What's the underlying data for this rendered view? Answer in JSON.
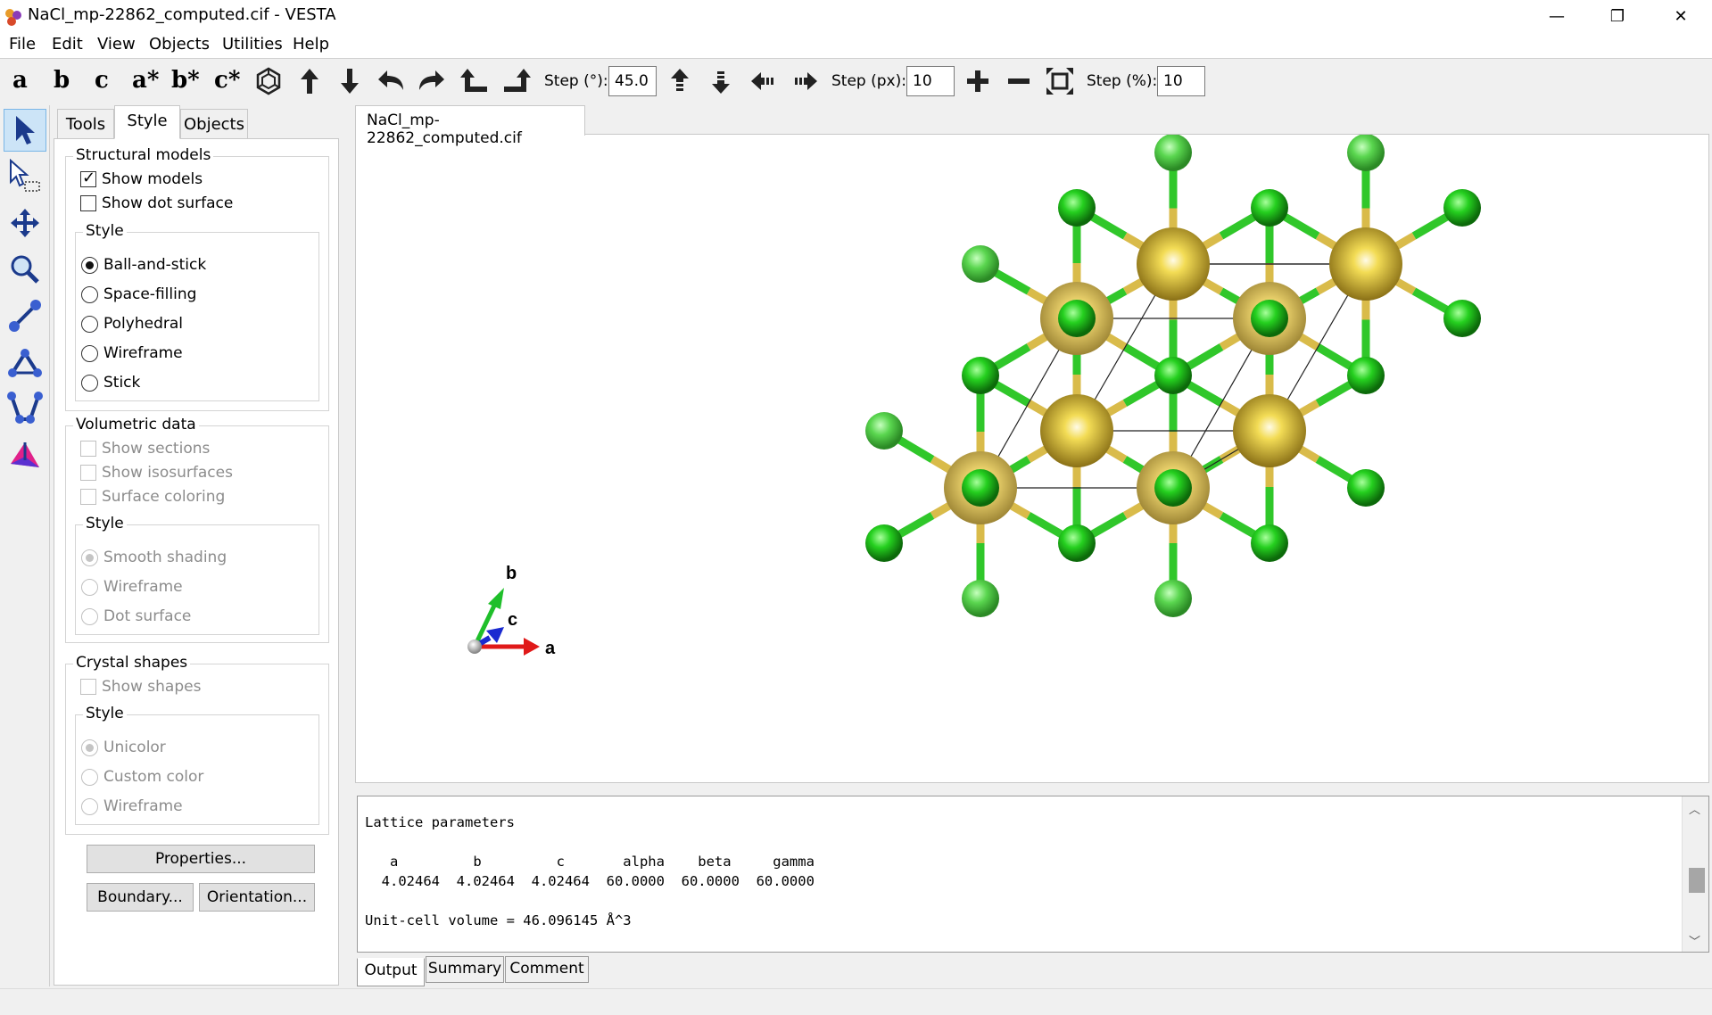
{
  "window": {
    "title": "NaCl_mp-22862_computed.cif - VESTA",
    "minimize_glyph": "—",
    "restore_glyph": "❐",
    "close_glyph": "✕"
  },
  "menu": [
    "File",
    "Edit",
    "View",
    "Objects",
    "Utilities",
    "Help"
  ],
  "toolbar": {
    "axis_buttons": [
      "a",
      "b",
      "c",
      "a*",
      "b*",
      "c*"
    ],
    "step_deg_label": "Step (°):",
    "step_deg_value": "45.0",
    "step_px_label": "Step (px):",
    "step_px_value": "10",
    "step_pct_label": "Step (%):",
    "step_pct_value": "10"
  },
  "tools": [
    "select-tool",
    "select-region-tool",
    "translate-tool",
    "magnify-tool",
    "distance-tool",
    "angle-tool",
    "dihedral-tool",
    "plane-tool"
  ],
  "side_tabs": [
    "Tools",
    "Style",
    "Objects"
  ],
  "active_side_tab": "Style",
  "structural_models": {
    "title": "Structural models",
    "show_models": "Show models",
    "show_dot_surface": "Show dot surface",
    "style_title": "Style",
    "styles": [
      "Ball-and-stick",
      "Space-filling",
      "Polyhedral",
      "Wireframe",
      "Stick"
    ],
    "selected_style": "Ball-and-stick"
  },
  "volumetric_data": {
    "title": "Volumetric data",
    "show_sections": "Show sections",
    "show_isosurfaces": "Show isosurfaces",
    "surface_coloring": "Surface coloring",
    "style_title": "Style",
    "styles": [
      "Smooth shading",
      "Wireframe",
      "Dot surface"
    ]
  },
  "crystal_shapes": {
    "title": "Crystal shapes",
    "show_shapes": "Show shapes",
    "style_title": "Style",
    "styles": [
      "Unicolor",
      "Custom color",
      "Wireframe"
    ]
  },
  "panel_buttons": {
    "properties": "Properties...",
    "boundary": "Boundary...",
    "orientation": "Orientation..."
  },
  "document_tab": "NaCl_mp-22862_computed.cif",
  "axes": {
    "a": "a",
    "b": "b",
    "c": "c"
  },
  "colors": {
    "na_atom": "#e6c53a",
    "cl_atom": "#22c41f",
    "axis_a": "#e01919",
    "axis_b": "#1fbf2a",
    "axis_c": "#1a2ad0",
    "selected_tool": "#cce4f7"
  },
  "output": {
    "heading": "Lattice parameters",
    "header_row": "   a         b         c       alpha    beta     gamma",
    "values_row": "  4.02464  4.02464  4.02464  60.0000  60.0000  60.0000",
    "volume": "Unit-cell volume = 46.096145 Å^3"
  },
  "output_tabs": [
    "Output",
    "Summary",
    "Comment"
  ],
  "active_output_tab": "Output"
}
